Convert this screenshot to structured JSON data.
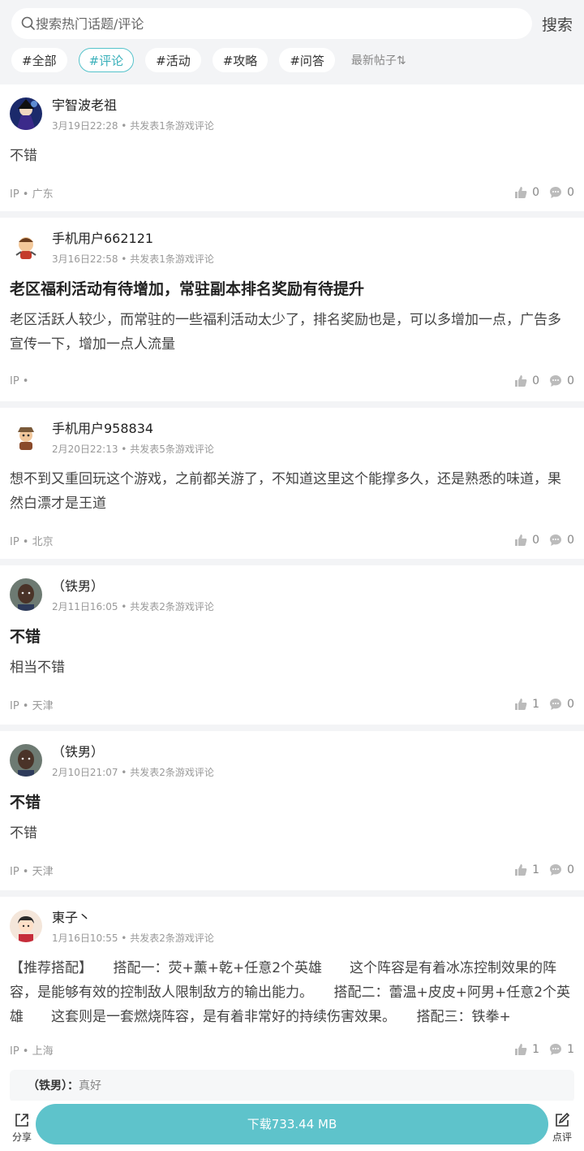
{
  "search": {
    "placeholder": "搜索热门话题/评论",
    "button": "搜索"
  },
  "tags": [
    "#全部",
    "#评论",
    "#活动",
    "#攻略",
    "#问答"
  ],
  "active_tag": "#评论",
  "sort": "最新帖子⇅",
  "posts": [
    {
      "username": "宇智波老祖",
      "meta": "3月19日22:28 • 共发表1条游戏评论",
      "title": "",
      "body": "不错",
      "ip": "IP • 广东",
      "likes": "0",
      "comments": "0",
      "avatar": "anime-avatar"
    },
    {
      "username": "手机用户662121",
      "meta": "3月16日22:58 • 共发表1条游戏评论",
      "title": "老区福利活动有待增加，常驻副本排名奖励有待提升",
      "body": "老区活跃人较少，而常驻的一些福利活动太少了，排名奖励也是，可以多增加一点，广告多宣传一下，增加一点人流量",
      "ip": "IP •",
      "likes": "0",
      "comments": "0",
      "avatar": "cartoon-avatar"
    },
    {
      "username": "手机用户958834",
      "meta": "2月20日22:13 • 共发表5条游戏评论",
      "title": "",
      "body": "想不到又重回玩这个游戏，之前都关游了，不知道这里这个能撑多久，还是熟悉的味道，果然白漂才是王道",
      "ip": "IP • 北京",
      "likes": "0",
      "comments": "0",
      "avatar": "cartoon-avatar"
    },
    {
      "username": "（铁男）",
      "meta": "2月11日16:05 • 共发表2条游戏评论",
      "title": "不错",
      "body": "相当不错",
      "ip": "IP • 天津",
      "likes": "1",
      "comments": "0",
      "avatar": "photo-avatar"
    },
    {
      "username": "（铁男）",
      "meta": "2月10日21:07 • 共发表2条游戏评论",
      "title": "不错",
      "body": "不错",
      "ip": "IP • 天津",
      "likes": "1",
      "comments": "0",
      "avatar": "photo-avatar"
    },
    {
      "username": "東子丶",
      "meta": "1月16日10:55 • 共发表2条游戏评论",
      "title": "",
      "body": "【推荐搭配】　　搭配一：荧+薰+乾+任意2个英雄　　这个阵容是有着冰冻控制效果的阵容，是能够有效的控制敌人限制敌方的输出能力。　　搭配二：蕾温+皮皮+阿男+任意2个英雄　　这套则是一套燃烧阵容，是有着非常好的持续伤害效果。　　搭配三：铁拳+",
      "ip": "IP • 上海",
      "likes": "1",
      "comments": "1",
      "avatar": "cartoon-boy-avatar"
    }
  ],
  "reply": {
    "name": "（铁男）：",
    "text": "真好"
  },
  "bottom": {
    "share": "分享",
    "download": "下载733.44 MB",
    "review": "点评"
  },
  "colors": {
    "accent": "#5ec3cb",
    "background": "#f3f4f6"
  }
}
